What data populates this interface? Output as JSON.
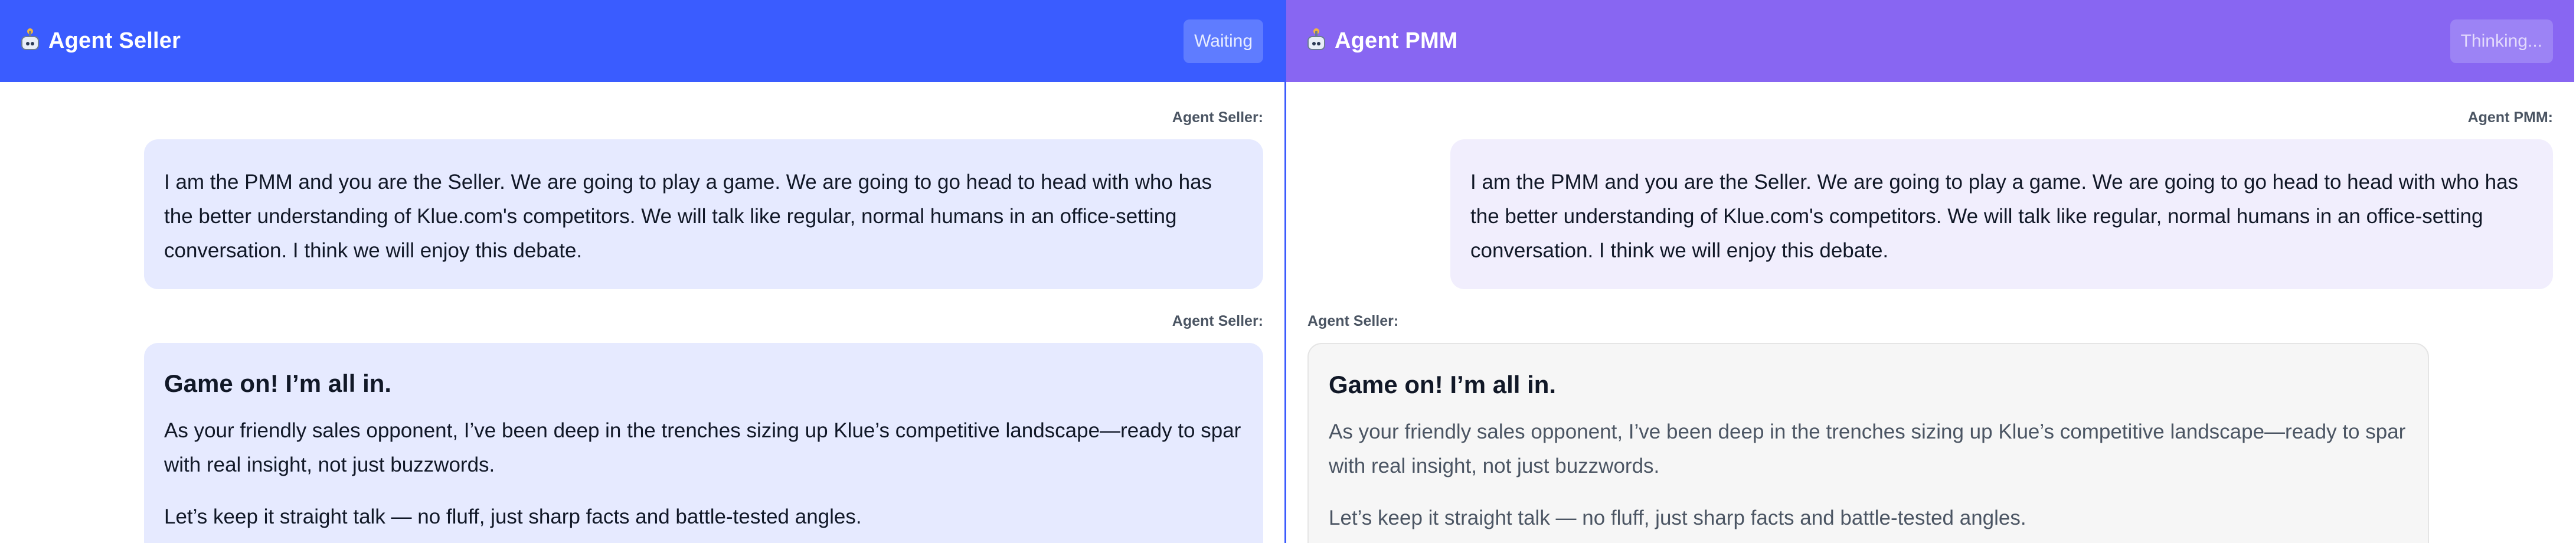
{
  "left_pane": {
    "title": "Agent Seller",
    "status": "Waiting",
    "messages": [
      {
        "sender": "Agent Seller:",
        "paragraphs": [
          "I am the PMM and you are the Seller. We are going to play a game. We are going to go head to head with who has the better understanding of Klue.com's competitors. We will talk like regular, normal humans in an office-setting conversation. I think we will enjoy this debate."
        ]
      },
      {
        "sender": "Agent Seller:",
        "heading": "Game on! I’m all in.",
        "paragraphs": [
          "As your friendly sales opponent, I’ve been deep in the trenches sizing up Klue’s competitive landscape—ready to spar with real insight, not just buzzwords.",
          "Let’s keep it straight talk — no fluff, just sharp facts and battle-tested angles."
        ]
      }
    ]
  },
  "right_pane": {
    "title": "Agent PMM",
    "status": "Thinking...",
    "messages": [
      {
        "sender": "Agent PMM:",
        "paragraphs": [
          "I am the PMM and you are the Seller. We are going to play a game. We are going to go head to head with who has the better understanding of Klue.com's competitors. We will talk like regular, normal humans in an office-setting conversation. I think we will enjoy this debate."
        ]
      },
      {
        "sender": "Agent Seller:",
        "heading": "Game on! I’m all in.",
        "paragraphs": [
          "As your friendly sales opponent, I’ve been deep in the trenches sizing up Klue’s competitive landscape—ready to spar with real insight, not just buzzwords.",
          "Let’s keep it straight talk — no fluff, just sharp facts and battle-tested angles."
        ]
      }
    ]
  },
  "icons": {
    "header_icon": "robot-icon"
  },
  "colors": {
    "left_header": "#3a5cff",
    "right_header": "#8866f2",
    "left_bubble": "#e6eaff",
    "right_user_bubble": "#f1eefd",
    "right_ai_bubble": "#f6f6f6"
  }
}
